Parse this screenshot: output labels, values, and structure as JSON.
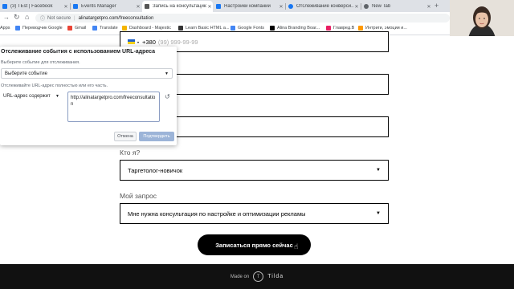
{
  "browser": {
    "tabs": [
      {
        "label": "(3) TEst | Facebook",
        "fav": "#1877f2"
      },
      {
        "label": "Events Manager",
        "fav": "#1877f2"
      },
      {
        "label": "Запись на консультацию",
        "fav": "#555555"
      },
      {
        "label": "Настройки компании",
        "fav": "#1877f2"
      },
      {
        "label": "Отслеживание конверси...",
        "fav": "#1877f2"
      },
      {
        "label": "New Tab",
        "fav": "#5f6368"
      }
    ],
    "active_tab": 2,
    "security": "Not secure",
    "url": "alinatargetpro.com/freeconsultation",
    "bookmarks": [
      {
        "label": "Apps",
        "color": "#4285f4"
      },
      {
        "label": "Переводчик Google",
        "color": "#4285f4"
      },
      {
        "label": "Gmail",
        "color": "#ea4335"
      },
      {
        "label": "Translate",
        "color": "#4285f4"
      },
      {
        "label": "Dashboard - Majestic",
        "color": "#f4b400"
      },
      {
        "label": "Learn Basic HTML a...",
        "color": "#333333"
      },
      {
        "label": "Google Fonts",
        "color": "#4285f4"
      },
      {
        "label": "Alina Branding Boar...",
        "color": "#000000"
      },
      {
        "label": "Главред.В",
        "color": "#e91e63"
      },
      {
        "label": "Интриги, эмоции и...",
        "color": "#ff9800"
      }
    ]
  },
  "form": {
    "phone_code": "+380",
    "phone_placeholder": "(99) 999-99-99",
    "who_label": "Кто я?",
    "who_value": "Таргетолог-новичок",
    "request_label": "Мой запрос",
    "request_value": "Мне нужна консультация по настройке и оптимизации рекламы",
    "cta": "Записаться прямо сейчас"
  },
  "footer": {
    "made_on": "Made on",
    "logo_letter": "T",
    "brand": "Tilda"
  },
  "popup": {
    "title": "Отслеживание события с использованием URL-адреса",
    "choose_event_text": "Выберите событие для отслеживания.",
    "event_select": "Выберите событие",
    "track_url_text": "Отслеживайте URL-адрес полностью или его часть.",
    "url_condition": "URL-адрес содержит",
    "url_value": "http://alinatargetpro.com/freeconsultation",
    "cancel": "Отмена",
    "confirm": "Подтвердить"
  }
}
